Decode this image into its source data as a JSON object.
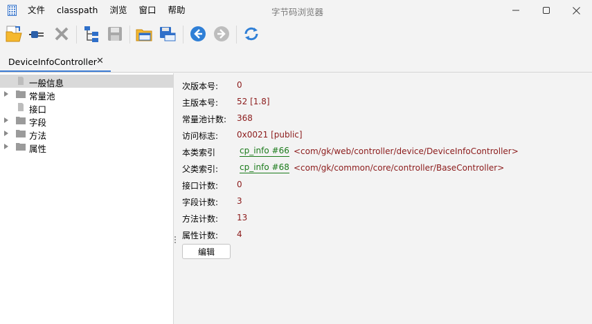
{
  "window": {
    "title": "字节码浏览器"
  },
  "menu": [
    {
      "label": "文件"
    },
    {
      "label": "classpath"
    },
    {
      "label": "浏览"
    },
    {
      "label": "窗口"
    },
    {
      "label": "帮助"
    }
  ],
  "toolbar": [
    "open-folder-icon",
    "plug-icon",
    "close-x-icon",
    "tree-structure-icon",
    "save-disk-icon",
    "open-folder-window-icon",
    "save-window-icon",
    "back-arrow-icon",
    "forward-arrow-icon",
    "refresh-icon"
  ],
  "tab": {
    "label": "DeviceInfoController",
    "close": "✕"
  },
  "tree": [
    {
      "label": "一般信息",
      "selected": true,
      "expandable": false
    },
    {
      "label": "常量池",
      "selected": false,
      "expandable": true
    },
    {
      "label": "接口",
      "selected": false,
      "expandable": false
    },
    {
      "label": "字段",
      "selected": false,
      "expandable": true
    },
    {
      "label": "方法",
      "selected": false,
      "expandable": true
    },
    {
      "label": "属性",
      "selected": false,
      "expandable": true
    }
  ],
  "info": {
    "minor_version": {
      "label": "次版本号:",
      "value": "0"
    },
    "major_version": {
      "label": "主版本号:",
      "value": "52 [1.8]"
    },
    "constant_pool_count": {
      "label": "常量池计数:",
      "value": "368"
    },
    "access_flags": {
      "label": "访问标志:",
      "value": "0x0021 [public]"
    },
    "this_class": {
      "label": "本类索引",
      "link": "cp_info #66",
      "desc": "<com/gk/web/controller/device/DeviceInfoController>"
    },
    "super_class": {
      "label": "父类索引:",
      "link": "cp_info #68",
      "desc": "<com/gk/common/core/controller/BaseController>"
    },
    "interfaces_count": {
      "label": "接口计数:",
      "value": "0"
    },
    "fields_count": {
      "label": "字段计数:",
      "value": "3"
    },
    "methods_count": {
      "label": "方法计数:",
      "value": "13"
    },
    "attributes_count": {
      "label": "属性计数:",
      "value": "4"
    },
    "edit_button": "编辑"
  }
}
